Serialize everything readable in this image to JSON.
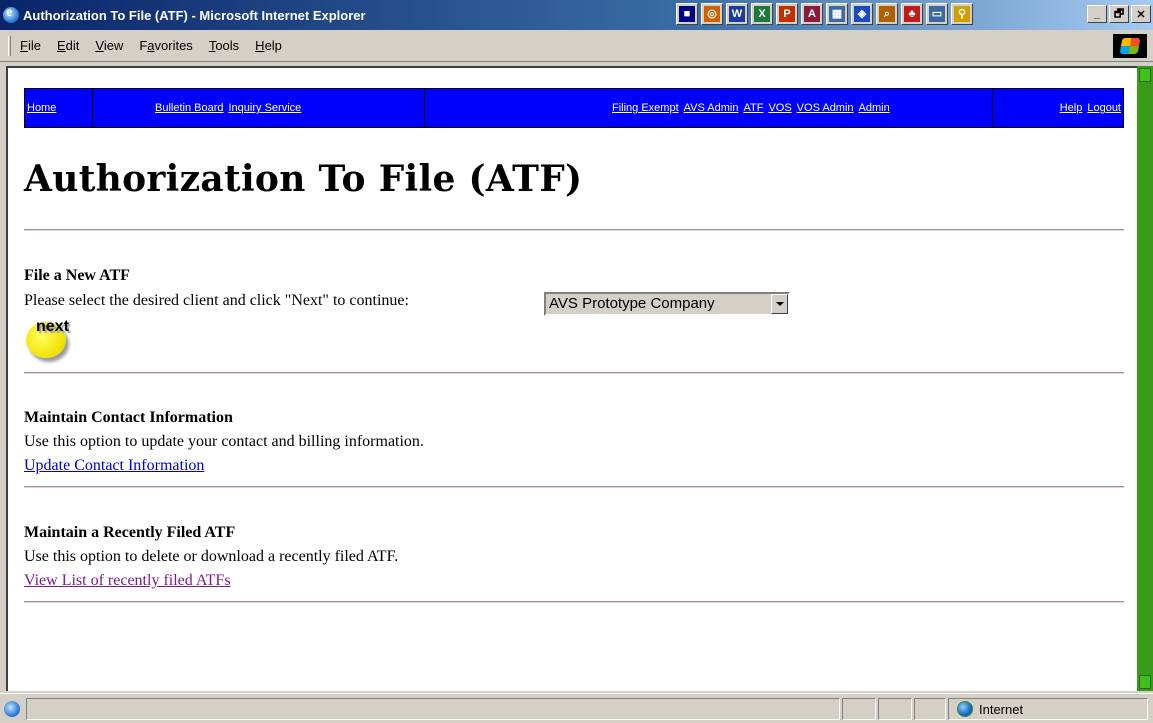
{
  "window": {
    "title": "Authorization To File (ATF) - Microsoft Internet Explorer",
    "controls": [
      "_",
      "🗗",
      "✕"
    ]
  },
  "menubar": {
    "items": [
      {
        "label": "File",
        "accel": "F",
        "rest": "ile"
      },
      {
        "label": "Edit",
        "accel": "E",
        "rest": "dit"
      },
      {
        "label": "View",
        "accel": "V",
        "rest": "iew"
      },
      {
        "label": "Favorites",
        "accel": "a",
        "pre": "F",
        "rest": "vorites"
      },
      {
        "label": "Tools",
        "accel": "T",
        "rest": "ools"
      },
      {
        "label": "Help",
        "accel": "H",
        "rest": "elp"
      }
    ]
  },
  "tray": {
    "icons": [
      {
        "name": "task-icon",
        "color": "#000080",
        "glyph": "■"
      },
      {
        "name": "outlook-icon",
        "color": "#d06000",
        "glyph": "◎"
      },
      {
        "name": "word-icon",
        "color": "#1a3c9a",
        "glyph": "W"
      },
      {
        "name": "excel-icon",
        "color": "#1a7a3a",
        "glyph": "X"
      },
      {
        "name": "powerpoint-icon",
        "color": "#c03000",
        "glyph": "P"
      },
      {
        "name": "access-icon",
        "color": "#8a1a3a",
        "glyph": "A"
      },
      {
        "name": "project-icon",
        "color": "#3a6aa0",
        "glyph": "▦"
      },
      {
        "name": "network-icon",
        "color": "#1a4ac0",
        "glyph": "◈"
      },
      {
        "name": "search-icon",
        "color": "#b06000",
        "glyph": "⌕"
      },
      {
        "name": "acrobat-icon",
        "color": "#c01a1a",
        "glyph": "♣"
      },
      {
        "name": "desktop-icon",
        "color": "#3a6aa0",
        "glyph": "▭"
      },
      {
        "name": "find-icon",
        "color": "#d0a000",
        "glyph": "⚲"
      }
    ]
  },
  "nav": {
    "home": "Home",
    "bulletin_board": "Bulletin Board",
    "inquiry_service": "Inquiry Service",
    "filing_exempt": "Filing Exempt",
    "avs_admin": "AVS Admin",
    "atf": "ATF",
    "vos": "VOS",
    "vos_admin": "VOS Admin",
    "admin": "Admin",
    "help": "Help",
    "logout": "Logout"
  },
  "page": {
    "title": "Authorization To File (ATF)",
    "new_atf": {
      "heading": "File a New ATF",
      "instruction": "Please select the desired client and click \"Next\" to continue:",
      "client_selected": "AVS Prototype Company",
      "next_label": "next"
    },
    "contact": {
      "heading": "Maintain Contact Information",
      "text": "Use this option to update your contact and billing information.",
      "link": "Update Contact Information"
    },
    "recent": {
      "heading": "Maintain a Recently Filed ATF",
      "text": "Use this option to delete or download a recently filed ATF.",
      "link": "View List of recently filed ATFs"
    }
  },
  "statusbar": {
    "zone": "Internet"
  }
}
